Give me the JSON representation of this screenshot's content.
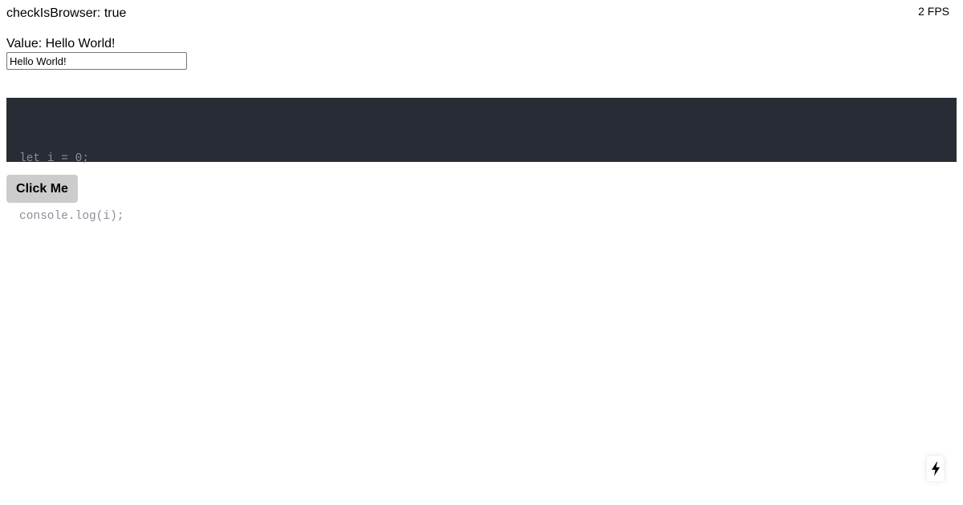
{
  "header": {
    "browser_check": "checkIsBrowser: true",
    "fps": "2 FPS"
  },
  "value_display": "Value: Hello World!",
  "input": {
    "value": "Hello World!"
  },
  "code": {
    "lines": [
      "let i = 0;",
      "console.log(i);"
    ]
  },
  "button": {
    "label": "Click Me"
  },
  "badge": {
    "icon": "lightning-bolt-icon"
  },
  "colors": {
    "code_background": "#282c34",
    "code_text": "#8a8f98",
    "button_background": "#cccccc"
  }
}
